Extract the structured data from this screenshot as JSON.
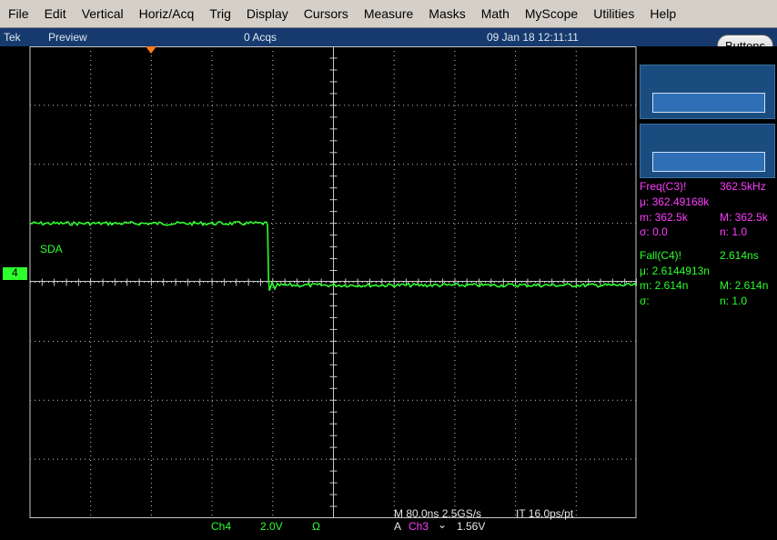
{
  "menu": [
    "File",
    "Edit",
    "Vertical",
    "Horiz/Acq",
    "Trig",
    "Display",
    "Cursors",
    "Measure",
    "Masks",
    "Math",
    "MyScope",
    "Utilities",
    "Help"
  ],
  "status": {
    "brand": "Tek",
    "mode": "Preview",
    "acqs": "0 Acqs",
    "datetime": "09 Jan 18 12:11:11"
  },
  "buttons_label": "Buttons",
  "channel": {
    "marker": "4",
    "label": "SDA",
    "color": "#2dff2d"
  },
  "measurements": {
    "freq": {
      "title": "Freq(C3)!",
      "value": "362.5kHz",
      "mu": "μ: 362.49168k",
      "m": "m: 362.5k",
      "M": "M: 362.5k",
      "sigma": "σ: 0.0",
      "n": "n: 1.0"
    },
    "fall": {
      "title": "Fall(C4)!",
      "value": "2.614ns",
      "mu": "μ: 2.6144913n",
      "m": "m: 2.614n",
      "M": "M: 2.614n",
      "sigma": "σ:",
      "n": "n: 1.0"
    }
  },
  "bottom": {
    "ch": "Ch4",
    "volts": "2.0V",
    "omega": "Ω",
    "timebase": "M 80.0ns 2.5GS/s",
    "it": "IT 16.0ps/pt",
    "trig_prefix": "A",
    "trig_src": "Ch3",
    "trig_slope": "⌄",
    "trig_level": "1.56V"
  },
  "waveform": {
    "high_div": 1.05,
    "low_div": -0.05,
    "edge_time_div": 3.9,
    "fall_time": "2.614ns"
  },
  "colors": {
    "trace": "#2dff2d",
    "grid": "#c8c8c8",
    "menubar": "#d4d0c8",
    "status": "#163a6e",
    "measure_freq": "#ff3cff",
    "trigger_marker": "#ff7a1a"
  }
}
